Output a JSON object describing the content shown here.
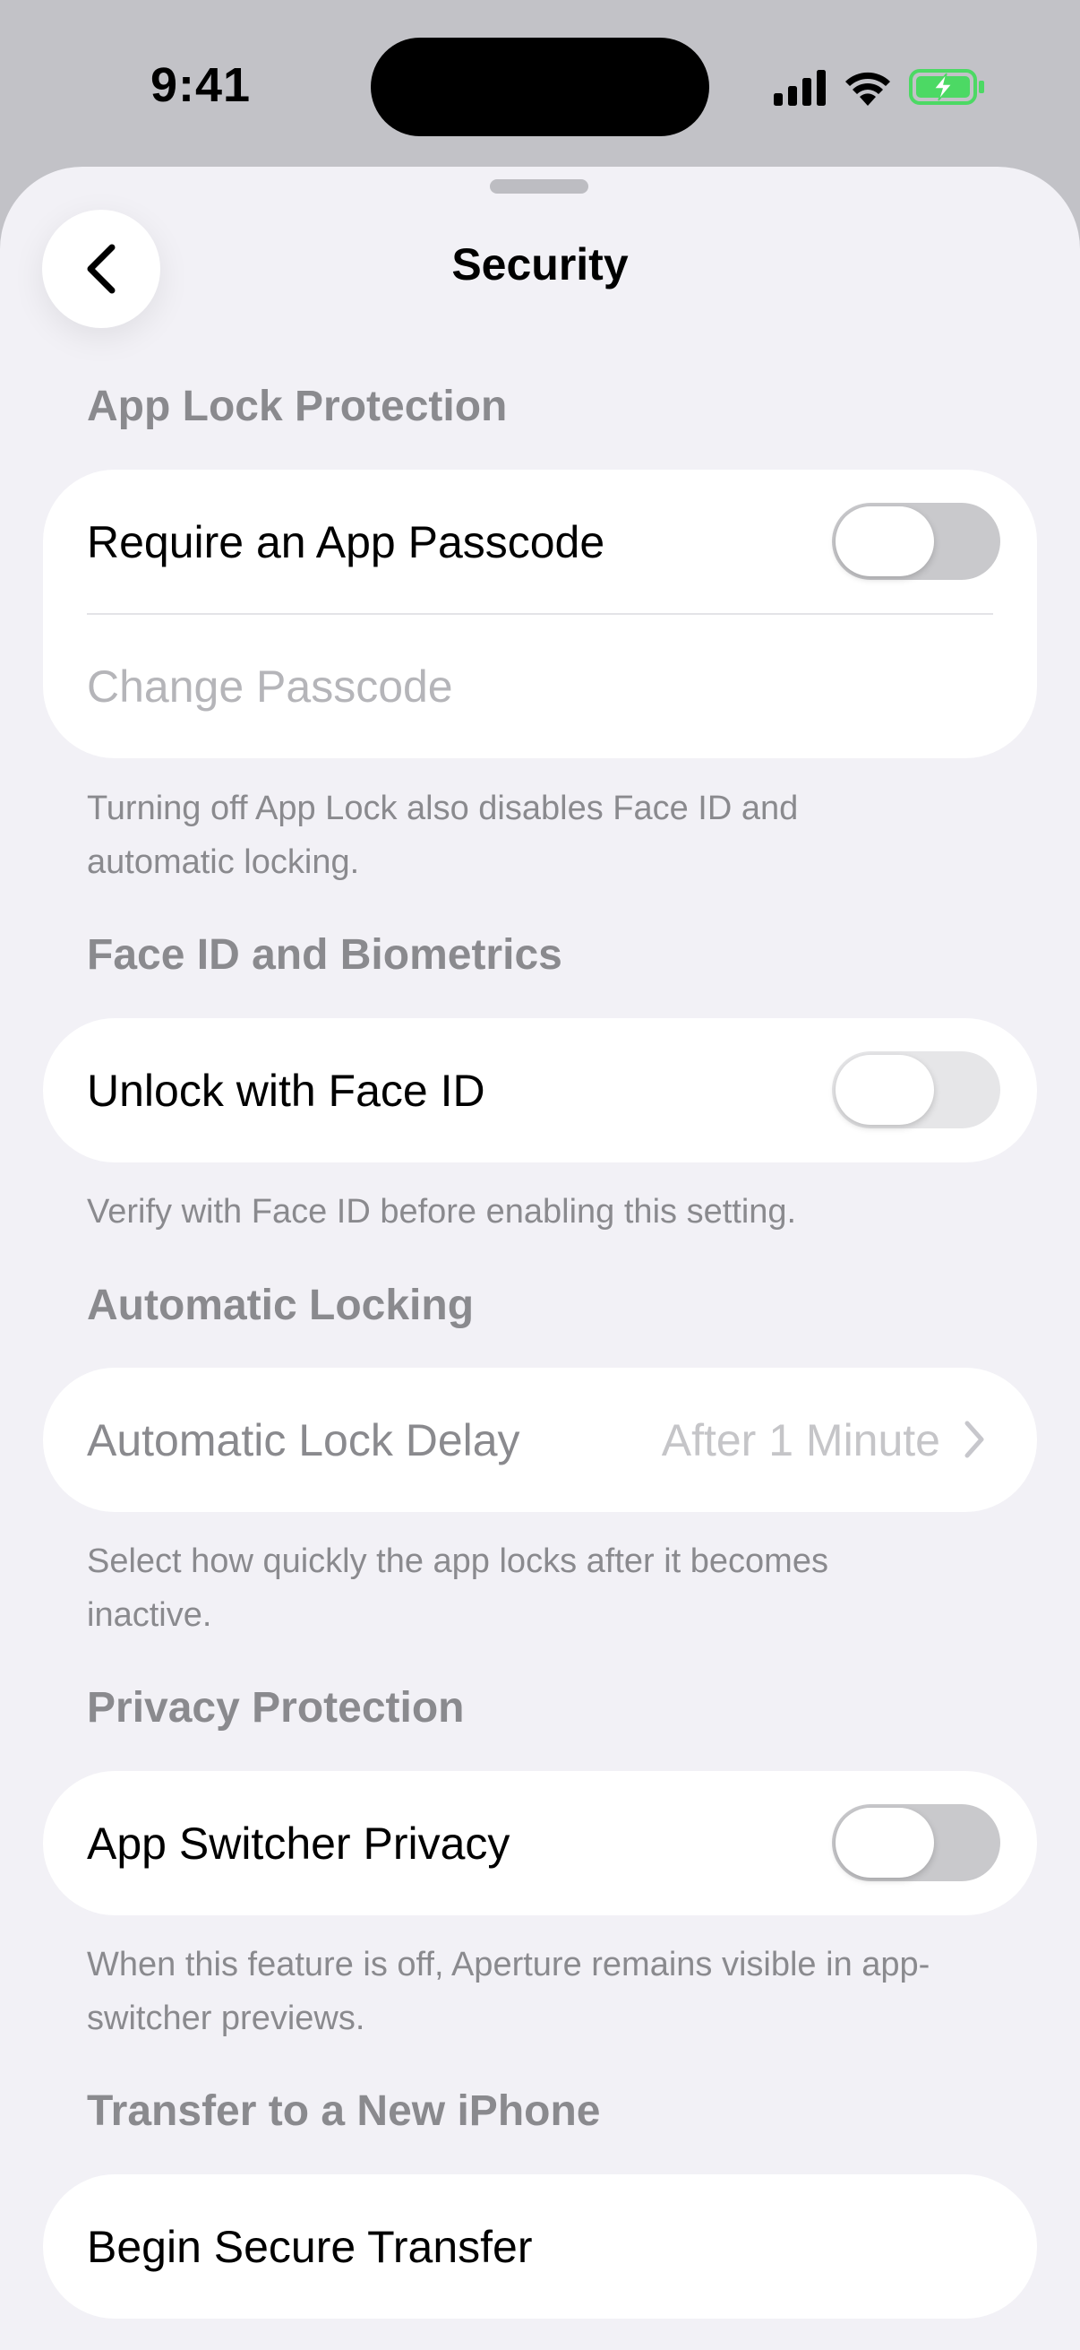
{
  "status_bar": {
    "time": "9:41",
    "icons": [
      "signal-icon",
      "wifi-icon",
      "battery-charging-icon"
    ],
    "battery_color": "#4cd964"
  },
  "nav": {
    "title": "Security",
    "back_icon": "chevron-left-icon"
  },
  "sections": {
    "app_lock": {
      "header": "App Lock Protection",
      "require_passcode_label": "Require an App Passcode",
      "require_passcode_on": false,
      "change_passcode_label": "Change Passcode",
      "footer": "Turning off App Lock also disables Face ID and automatic locking."
    },
    "face_id": {
      "header": "Face ID and Biometrics",
      "unlock_label": "Unlock with Face ID",
      "unlock_on": false,
      "footer": "Verify with Face ID before enabling this setting."
    },
    "auto_lock": {
      "header": "Automatic Locking",
      "delay_label": "Automatic Lock Delay",
      "delay_value": "After 1 Minute",
      "footer": "Select how quickly the app locks after it becomes inactive."
    },
    "privacy": {
      "header": "Privacy Protection",
      "switcher_label": "App Switcher Privacy",
      "switcher_on": false,
      "footer": "When this feature is off, Aperture remains visible in app-switcher previews."
    },
    "transfer": {
      "header": "Transfer to a New iPhone",
      "begin_label": "Begin Secure Transfer"
    }
  }
}
